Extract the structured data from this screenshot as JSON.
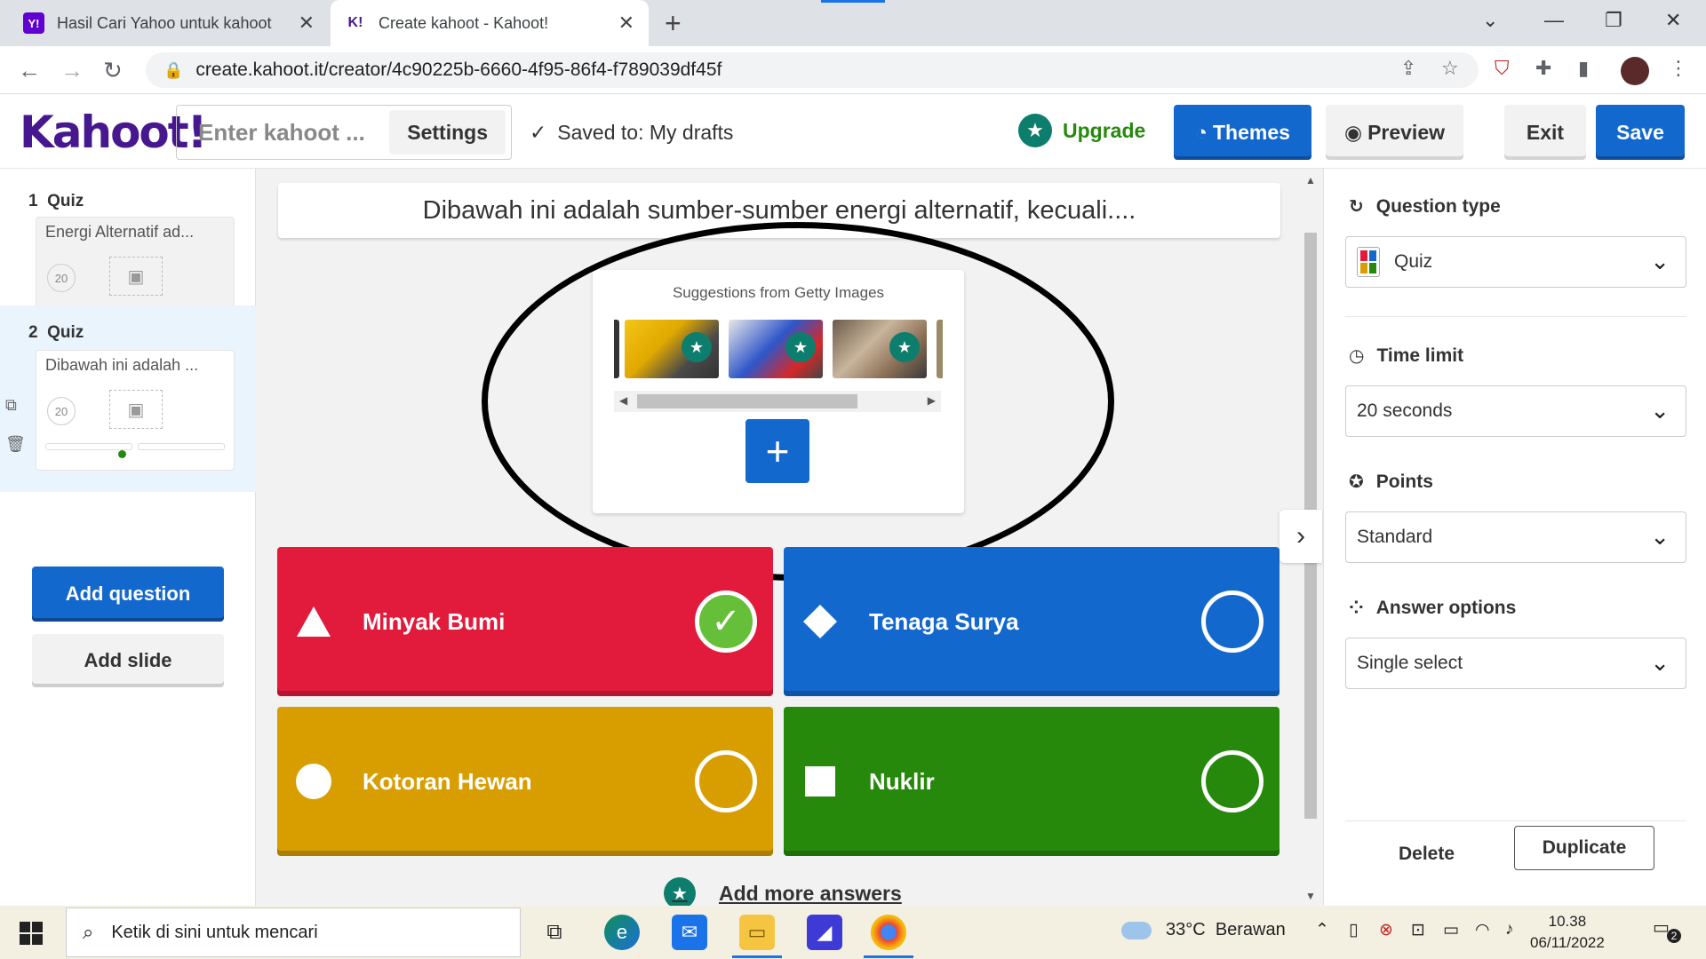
{
  "browser": {
    "tabs": [
      {
        "favicon": "Y!",
        "title": "Hasil Cari Yahoo untuk kahoot",
        "active": false
      },
      {
        "favicon": "K!",
        "title": "Create kahoot - Kahoot!",
        "active": true
      }
    ],
    "url": "create.kahoot.it/creator/4c90225b-6660-4f95-86f4-f789039df45f"
  },
  "header": {
    "logo": "Kahoot!",
    "title_placeholder": "Enter kahoot ...",
    "settings_label": "Settings",
    "saved_status": "Saved to: My drafts",
    "upgrade_label": "Upgrade",
    "themes_label": "Themes",
    "preview_label": "Preview",
    "exit_label": "Exit",
    "save_label": "Save"
  },
  "sidebar": {
    "slides": [
      {
        "number": "1",
        "type": "Quiz",
        "question": "Energi Alternatif ad...",
        "time": "20"
      },
      {
        "number": "2",
        "type": "Quiz",
        "question": "Dibawah ini adalah ...",
        "time": "20"
      }
    ],
    "add_question_label": "Add question",
    "add_slide_label": "Add slide"
  },
  "editor": {
    "question": "Dibawah ini adalah  sumber-sumber energi alternatif, kecuali....",
    "media_caption": "Suggestions from Getty Images",
    "answers": [
      {
        "shape": "triangle",
        "text": "Minyak Bumi",
        "color": "#e21b3c",
        "correct": true
      },
      {
        "shape": "diamond",
        "text": "Tenaga Surya",
        "color": "#1368ce",
        "correct": false
      },
      {
        "shape": "circle",
        "text": "Kotoran Hewan",
        "color": "#d89e00",
        "correct": false
      },
      {
        "shape": "square",
        "text": "Nuklir",
        "color": "#26890c",
        "correct": false
      }
    ],
    "add_more_answers": "Add more answers"
  },
  "settings_panel": {
    "question_type_label": "Question type",
    "question_type_value": "Quiz",
    "time_limit_label": "Time limit",
    "time_limit_value": "20 seconds",
    "points_label": "Points",
    "points_value": "Standard",
    "answer_options_label": "Answer options",
    "answer_options_value": "Single select",
    "delete_label": "Delete",
    "duplicate_label": "Duplicate"
  },
  "taskbar": {
    "search_placeholder": "Ketik di sini untuk mencari",
    "temperature": "33°C",
    "weather": "Berawan",
    "time": "10.38",
    "date": "06/11/2022",
    "notification_count": "2"
  }
}
